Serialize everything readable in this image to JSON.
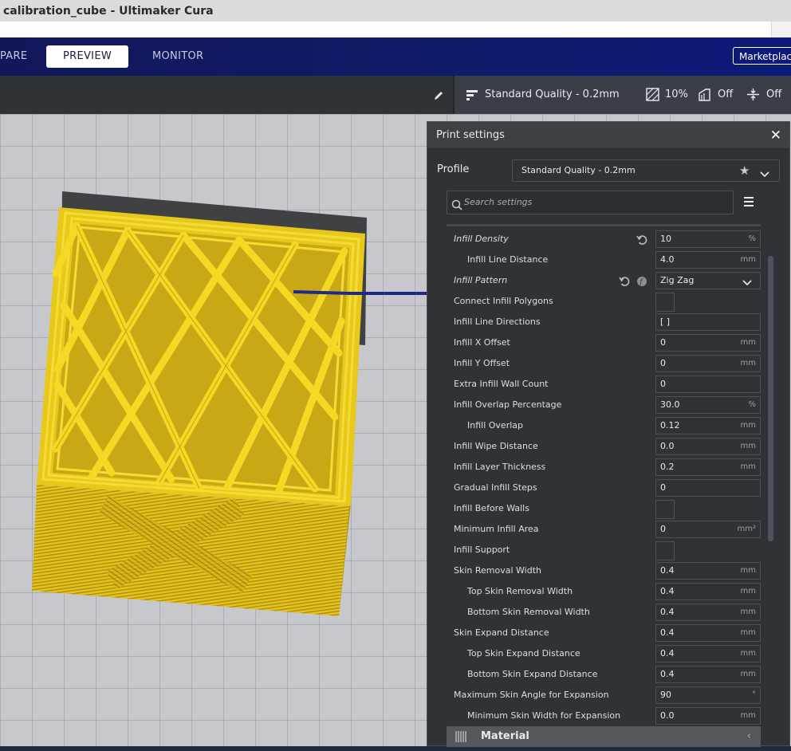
{
  "window": {
    "title": "calibration_cube - Ultimaker Cura"
  },
  "header": {
    "tabs": [
      {
        "label": "PARE",
        "active": false
      },
      {
        "label": "PREVIEW",
        "active": true
      },
      {
        "label": "MONITOR",
        "active": false
      }
    ],
    "marketplace_label": "Marketplace"
  },
  "toolbar": {
    "quality": "Standard Quality - 0.2mm",
    "infill": "10%",
    "support": "Off",
    "adhesion": "Off"
  },
  "panel": {
    "title": "Print settings",
    "profile_label": "Profile",
    "profile_value": "Standard Quality - 0.2mm",
    "search_placeholder": "Search settings",
    "settings": [
      {
        "label": "Infill Density",
        "value": "10",
        "unit": "%",
        "type": "field",
        "indent": false,
        "italic": true,
        "reset": true,
        "linked": false
      },
      {
        "label": "Infill Line Distance",
        "value": "4.0",
        "unit": "mm",
        "type": "field",
        "indent": true,
        "italic": false,
        "reset": false,
        "linked": false
      },
      {
        "label": "Infill Pattern",
        "value": "Zig Zag",
        "unit": "",
        "type": "dropdown",
        "indent": false,
        "italic": true,
        "reset": true,
        "linked": true
      },
      {
        "label": "Connect Infill Polygons",
        "value": "",
        "unit": "",
        "type": "checkbox",
        "indent": false,
        "italic": false,
        "reset": false,
        "linked": false
      },
      {
        "label": "Infill Line Directions",
        "value": "[ ]",
        "unit": "",
        "type": "field",
        "indent": false,
        "italic": false,
        "reset": false,
        "linked": false
      },
      {
        "label": "Infill X Offset",
        "value": "0",
        "unit": "mm",
        "type": "field",
        "indent": false,
        "italic": false,
        "reset": false,
        "linked": false
      },
      {
        "label": "Infill Y Offset",
        "value": "0",
        "unit": "mm",
        "type": "field",
        "indent": false,
        "italic": false,
        "reset": false,
        "linked": false
      },
      {
        "label": "Extra Infill Wall Count",
        "value": "0",
        "unit": "",
        "type": "field",
        "indent": false,
        "italic": false,
        "reset": false,
        "linked": false
      },
      {
        "label": "Infill Overlap Percentage",
        "value": "30.0",
        "unit": "%",
        "type": "field",
        "indent": false,
        "italic": false,
        "reset": false,
        "linked": false
      },
      {
        "label": "Infill Overlap",
        "value": "0.12",
        "unit": "mm",
        "type": "field",
        "indent": true,
        "italic": false,
        "reset": false,
        "linked": false
      },
      {
        "label": "Infill Wipe Distance",
        "value": "0.0",
        "unit": "mm",
        "type": "field",
        "indent": false,
        "italic": false,
        "reset": false,
        "linked": false
      },
      {
        "label": "Infill Layer Thickness",
        "value": "0.2",
        "unit": "mm",
        "type": "field",
        "indent": false,
        "italic": false,
        "reset": false,
        "linked": false
      },
      {
        "label": "Gradual Infill Steps",
        "value": "0",
        "unit": "",
        "type": "field",
        "indent": false,
        "italic": false,
        "reset": false,
        "linked": false
      },
      {
        "label": "Infill Before Walls",
        "value": "",
        "unit": "",
        "type": "checkbox",
        "indent": false,
        "italic": false,
        "reset": false,
        "linked": false
      },
      {
        "label": "Minimum Infill Area",
        "value": "0",
        "unit": "mm²",
        "type": "field",
        "indent": false,
        "italic": false,
        "reset": false,
        "linked": false
      },
      {
        "label": "Infill Support",
        "value": "",
        "unit": "",
        "type": "checkbox",
        "indent": false,
        "italic": false,
        "reset": false,
        "linked": false
      },
      {
        "label": "Skin Removal Width",
        "value": "0.4",
        "unit": "mm",
        "type": "field",
        "indent": false,
        "italic": false,
        "reset": false,
        "linked": false
      },
      {
        "label": "Top Skin Removal Width",
        "value": "0.4",
        "unit": "mm",
        "type": "field",
        "indent": true,
        "italic": false,
        "reset": false,
        "linked": false
      },
      {
        "label": "Bottom Skin Removal Width",
        "value": "0.4",
        "unit": "mm",
        "type": "field",
        "indent": true,
        "italic": false,
        "reset": false,
        "linked": false
      },
      {
        "label": "Skin Expand Distance",
        "value": "0.4",
        "unit": "mm",
        "type": "field",
        "indent": false,
        "italic": false,
        "reset": false,
        "linked": false
      },
      {
        "label": "Top Skin Expand Distance",
        "value": "0.4",
        "unit": "mm",
        "type": "field",
        "indent": true,
        "italic": false,
        "reset": false,
        "linked": false
      },
      {
        "label": "Bottom Skin Expand Distance",
        "value": "0.4",
        "unit": "mm",
        "type": "field",
        "indent": true,
        "italic": false,
        "reset": false,
        "linked": false
      },
      {
        "label": "Maximum Skin Angle for Expansion",
        "value": "90",
        "unit": "°",
        "type": "field",
        "indent": false,
        "italic": false,
        "reset": false,
        "linked": false
      },
      {
        "label": "Minimum Skin Width for Expansion",
        "value": "0.0",
        "unit": "mm",
        "type": "field",
        "indent": true,
        "italic": false,
        "reset": false,
        "linked": false
      }
    ],
    "next_category": "Material"
  },
  "colors": {
    "model_fill": "#e8c51b",
    "model_line": "#f7e03a",
    "model_shadow": "#6e6a58",
    "header_bg": "#12175a"
  }
}
